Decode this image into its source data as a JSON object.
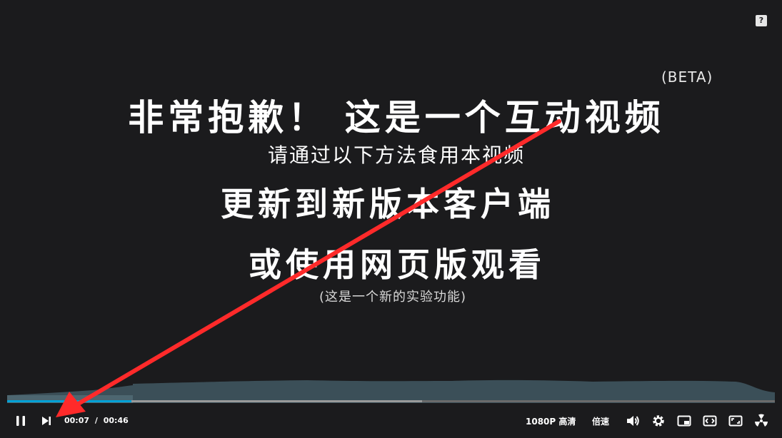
{
  "overlay": {
    "beta": "(BETA)",
    "line1": "非常抱歉！ 这是一个互动视频",
    "line2": "请通过以下方法食用本视频",
    "line3": "更新到新版本客户端",
    "line4": "或使用网页版观看",
    "line5": "(这是一个新的实验功能)"
  },
  "help_label": "?",
  "player": {
    "current_time": "00:07",
    "separator": "/",
    "duration": "00:46",
    "progress_fraction": 0.162,
    "buffered_fraction": 0.54,
    "quality_label": "1080P 高清",
    "speed_label": "倍速"
  },
  "colors": {
    "accent": "#00a1d6",
    "annotation_arrow": "#ff2a2a",
    "heat_wave": "#3d5560"
  },
  "icons": [
    "pause-icon",
    "next-icon",
    "volume-icon",
    "settings-icon",
    "pip-icon",
    "widescreen-icon",
    "fullscreen-icon",
    "danmaku-icon",
    "help-icon"
  ]
}
